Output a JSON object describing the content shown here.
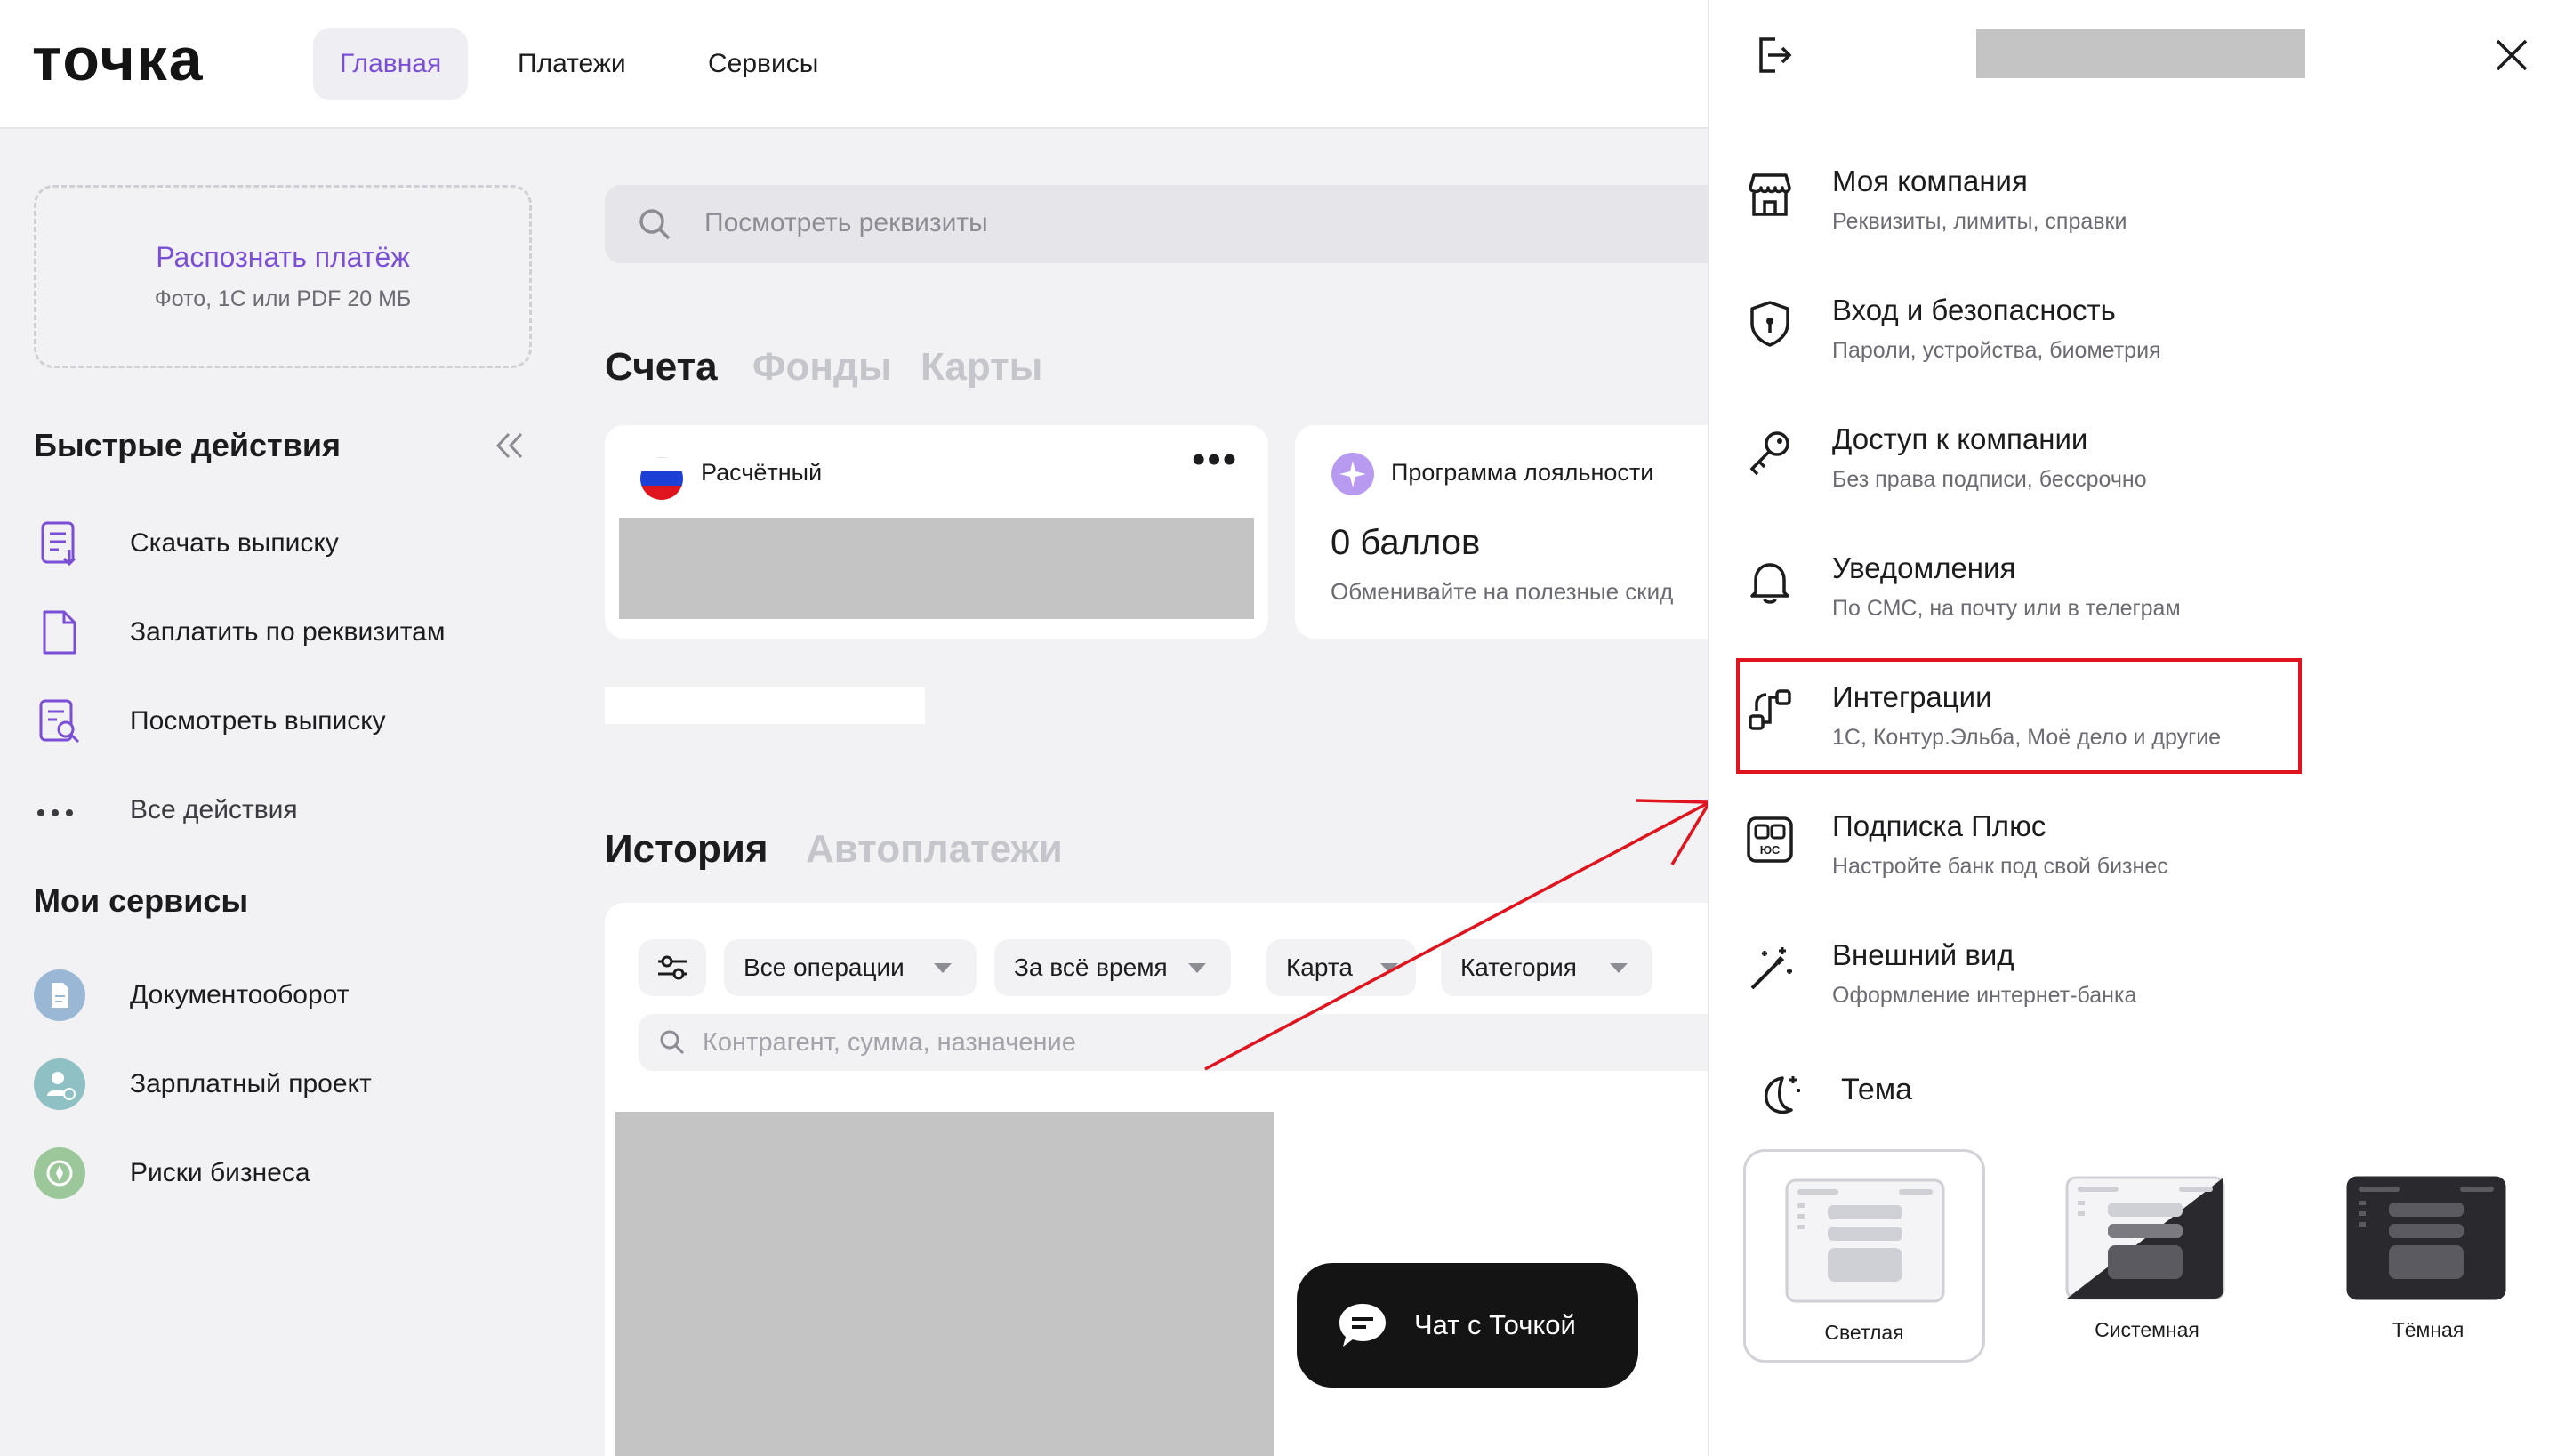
{
  "header": {
    "logo": "точка",
    "nav": [
      {
        "label": "Главная",
        "active": true
      },
      {
        "label": "Платежи",
        "active": false
      },
      {
        "label": "Сервисы",
        "active": false
      }
    ]
  },
  "sidebar": {
    "recognize": {
      "title": "Распознать платёж",
      "subtitle": "Фото, 1С или PDF 20 МБ"
    },
    "quick_actions_title": "Быстрые действия",
    "quick_actions": [
      {
        "label": "Скачать выписку",
        "icon": "download-statement-icon"
      },
      {
        "label": "Заплатить по реквизитам",
        "icon": "document-icon"
      },
      {
        "label": "Посмотреть выписку",
        "icon": "view-statement-icon"
      },
      {
        "label": "Все действия",
        "icon": "more-dots-icon"
      }
    ],
    "services_title": "Мои сервисы",
    "services": [
      {
        "label": "Документооборот",
        "icon": "document-flow-icon"
      },
      {
        "label": "Зарплатный проект",
        "icon": "salary-project-icon"
      },
      {
        "label": "Риски бизнеса",
        "icon": "business-risk-icon"
      }
    ]
  },
  "main": {
    "search_placeholder": "Посмотреть реквизиты",
    "account_tabs": [
      "Счета",
      "Фонды",
      "Карты"
    ],
    "account_card": {
      "title": "Расчётный"
    },
    "loyalty_card": {
      "title": "Программа лояльности",
      "value": "0 баллов",
      "desc": "Обменивайте на полезные скид"
    },
    "history_tabs": [
      "История",
      "Автоплатежи"
    ],
    "filters": [
      "Все операции",
      "За всё время",
      "Карта",
      "Категория"
    ],
    "history_search_placeholder": "Контрагент, сумма, назначение",
    "chat_button": "Чат с Точкой"
  },
  "drawer": {
    "menu": [
      {
        "title": "Моя компания",
        "subtitle": "Реквизиты, лимиты, справки",
        "icon": "store-icon"
      },
      {
        "title": "Вход и безопасность",
        "subtitle": "Пароли, устройства, биометрия",
        "icon": "shield-icon"
      },
      {
        "title": "Доступ к компании",
        "subtitle": "Без права подписи, бессрочно",
        "icon": "key-icon"
      },
      {
        "title": "Уведомления",
        "subtitle": "По СМС, на почту или в телеграм",
        "icon": "bell-icon"
      },
      {
        "title": "Интеграции",
        "subtitle": "1С, Контур.Эльба, Моё дело и другие",
        "icon": "integration-icon"
      },
      {
        "title": "Подписка Плюс",
        "subtitle": "Настройте банк под свой бизнес",
        "icon": "subscription-icon"
      },
      {
        "title": "Внешний вид",
        "subtitle": "Оформление интернет-банка",
        "icon": "magic-wand-icon"
      }
    ],
    "theme_title": "Тема",
    "themes": [
      {
        "label": "Светлая",
        "selected": true
      },
      {
        "label": "Системная",
        "selected": false
      },
      {
        "label": "Тёмная",
        "selected": false
      }
    ]
  },
  "colors": {
    "accent": "#7a4fd6",
    "highlight": "#e0141e",
    "chat_bg": "#141414"
  }
}
